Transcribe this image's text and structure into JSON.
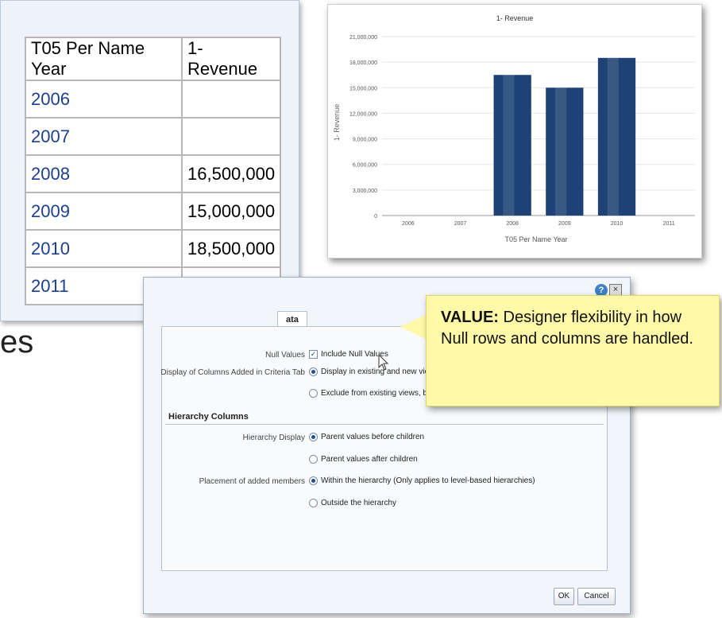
{
  "table": {
    "headers": [
      "T05 Per Name Year",
      "1- Revenue"
    ],
    "rows": [
      {
        "year": "2006",
        "revenue": ""
      },
      {
        "year": "2007",
        "revenue": ""
      },
      {
        "year": "2008",
        "revenue": "16,500,000"
      },
      {
        "year": "2009",
        "revenue": "15,000,000"
      },
      {
        "year": "2010",
        "revenue": "18,500,000"
      },
      {
        "year": "2011",
        "revenue": ""
      }
    ]
  },
  "background_text": "es",
  "chart_data": {
    "type": "bar",
    "title": "1- Revenue",
    "xlabel": "T05 Per Name Year",
    "ylabel": "1- Revenue",
    "categories": [
      "2006",
      "2007",
      "2008",
      "2009",
      "2010",
      "2011"
    ],
    "values": [
      null,
      null,
      16500000,
      15000000,
      18500000,
      null
    ],
    "ylim": [
      0,
      21000000
    ],
    "yticks": [
      "0",
      "3,000,000",
      "6,000,000",
      "9,000,000",
      "12,000,000",
      "15,000,000",
      "18,000,000",
      "21,000,000"
    ],
    "grid": true,
    "bar_color": "#1e4275"
  },
  "dialog": {
    "tab_label": "ata",
    "null_values": {
      "label": "Null Values",
      "checkbox": "Include Null Values",
      "checked": true
    },
    "display_columns": {
      "label": "Display of Columns Added in Criteria Tab",
      "option1": "Display in existing and new views",
      "option2": "Exclude from existing views, but d"
    },
    "hierarchy_section": "Hierarchy Columns",
    "hierarchy_display": {
      "label": "Hierarchy Display",
      "option1": "Parent values before children",
      "option2": "Parent values after children"
    },
    "placement": {
      "label": "Placement of added members",
      "option1": "Within the hierarchy (Only applies to level-based hierarchies)",
      "option2": "Outside the hierarchy"
    },
    "ok_label": "OK",
    "cancel_label": "Cancel",
    "help_glyph": "?",
    "close_glyph": "×"
  },
  "callout": {
    "heading": "VALUE:",
    "text": "Designer flexibility in how Null rows and columns are handled."
  }
}
